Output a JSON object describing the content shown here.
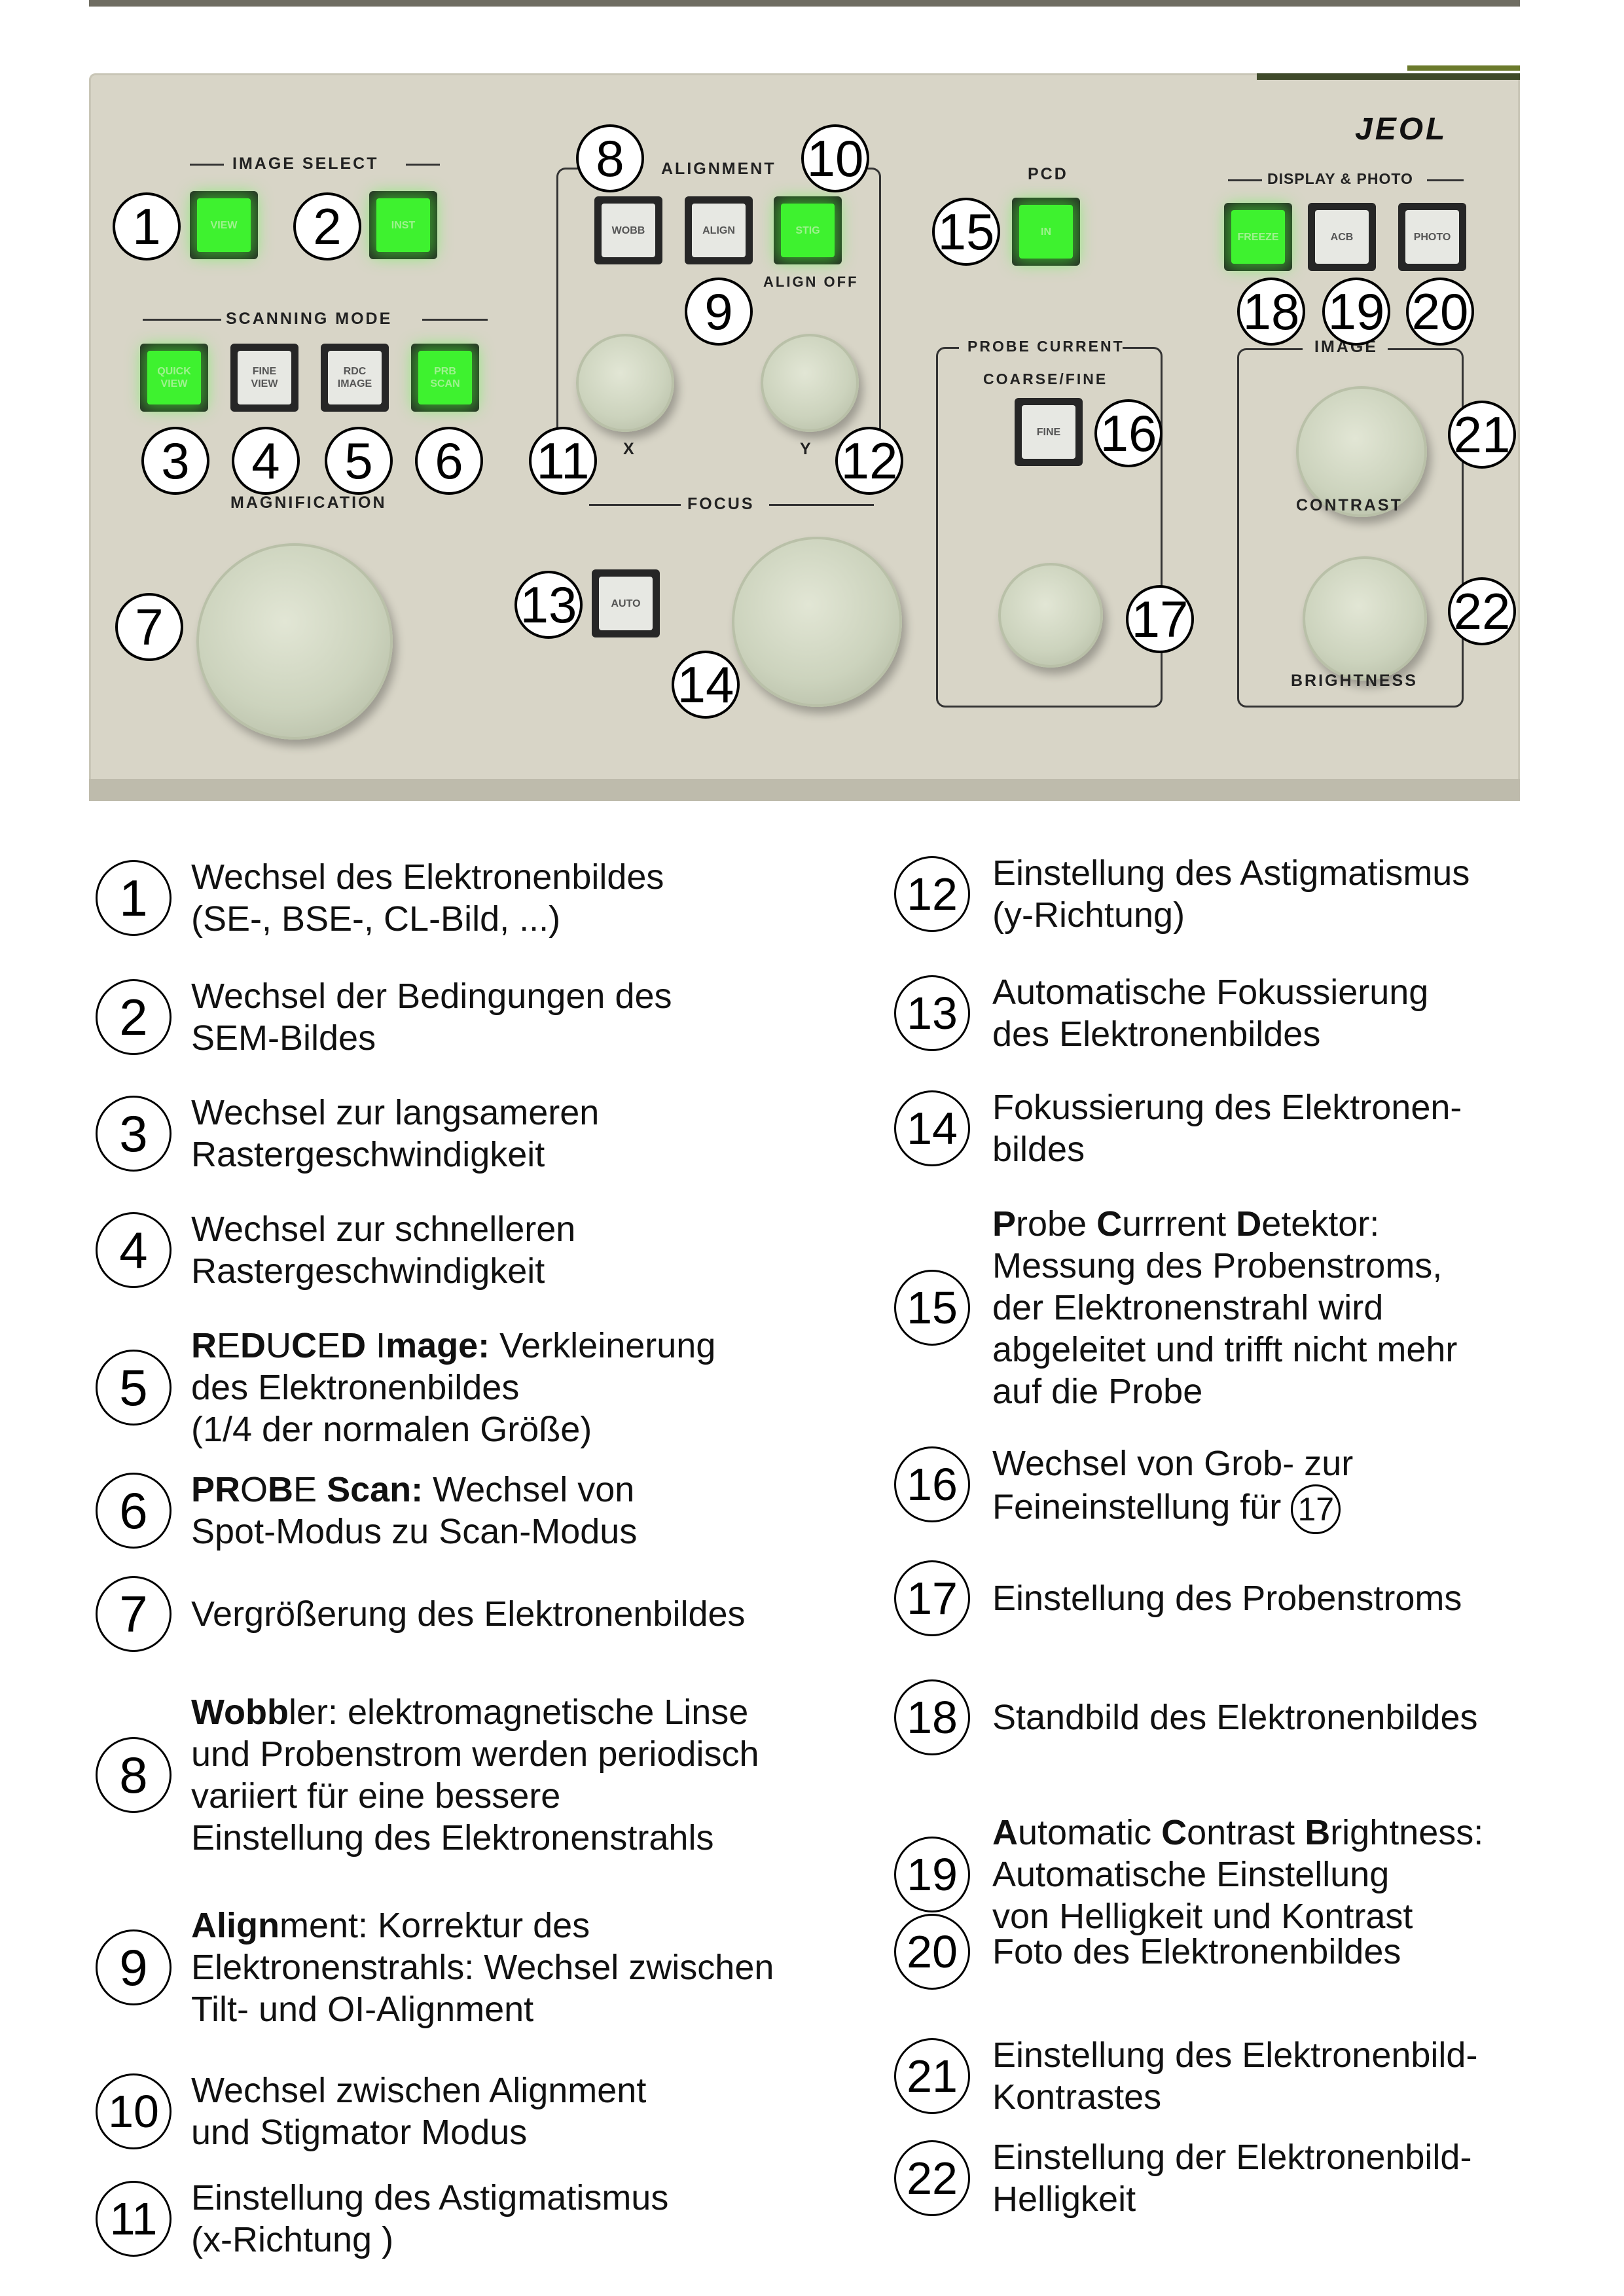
{
  "panel": {
    "brand": "JEOL",
    "sections": {
      "image_select": "IMAGE  SELECT",
      "scanning_mode": "SCANNING  MODE",
      "magnification": "MAGNIFICATION",
      "alignment": "ALIGNMENT",
      "align_off": "ALIGN  OFF",
      "focus": "FOCUS",
      "pcd": "PCD",
      "probe_current": "PROBE  CURRENT",
      "coarse_fine": "COARSE/FINE",
      "display_photo": "DISPLAY & PHOTO",
      "image": "IMAGE",
      "contrast": "CONTRAST",
      "brightness": "BRIGHTNESS",
      "x": "X",
      "y": "Y"
    },
    "buttons": {
      "view": "VIEW",
      "inst": "INST",
      "quick_view": "QUICK\nVIEW",
      "fine_view": "FINE\nVIEW",
      "rdc_image": "RDC\nIMAGE",
      "prb_scan": "PRB\nSCAN",
      "wobb": "WOBB",
      "align": "ALIGN",
      "stig": "STIG",
      "pcd_in": "IN",
      "fine": "FINE",
      "auto": "AUTO",
      "freeze": "FREEZE",
      "acb": "ACB",
      "photo": "PHOTO"
    },
    "callouts": [
      "1",
      "2",
      "3",
      "4",
      "5",
      "6",
      "7",
      "8",
      "9",
      "10",
      "11",
      "12",
      "13",
      "14",
      "15",
      "16",
      "17",
      "18",
      "19",
      "20",
      "21",
      "22"
    ]
  },
  "legend": {
    "left": [
      {
        "num": "1",
        "text": "Wechsel des Elektronenbildes\n(SE-, BSE-, CL-Bild, ...)"
      },
      {
        "num": "2",
        "text": "Wechsel der Bedingungen des\nSEM-Bildes"
      },
      {
        "num": "3",
        "text": "Wechsel zur langsameren\nRastergeschwindigkeit"
      },
      {
        "num": "4",
        "text": "Wechsel zur schnelleren\nRastergeschwindigkeit"
      },
      {
        "num": "5",
        "text": "REDUCED Image: Verkleinerung\ndes Elektronenbildes\n(1/4 der normalen Größe)"
      },
      {
        "num": "6",
        "text": "PROBE Scan: Wechsel von\nSpot-Modus zu Scan-Modus"
      },
      {
        "num": "7",
        "text": "Vergrößerung des Elektronenbildes"
      },
      {
        "num": "8",
        "text": "Wobbler: elektromagnetische Linse\nund Probenstrom  werden periodisch\nvariiert für eine bessere\nEinstellung des Elektronenstrahls"
      },
      {
        "num": "9",
        "text": "Alignment: Korrektur des\nElektronenstrahls: Wechsel zwischen\nTilt- und OI-Alignment"
      },
      {
        "num": "10",
        "text": "Wechsel zwischen Alignment\nund Stigmator Modus"
      },
      {
        "num": "11",
        "text": "Einstellung des Astigmatismus\n(x-Richtung )"
      }
    ],
    "right": [
      {
        "num": "12",
        "text": "Einstellung des Astigmatismus\n(y-Richtung)"
      },
      {
        "num": "13",
        "text": "Automatische Fokussierung\ndes Elektronenbildes"
      },
      {
        "num": "14",
        "text": "Fokussierung des Elektronen-\nbildes"
      },
      {
        "num": "15",
        "text": "Probe Currrent Detektor:\nMessung des Probenstroms,\nder Elektronenstrahl wird\nabgeleitet und  trifft nicht mehr\nauf die Probe"
      },
      {
        "num": "16",
        "text": "Wechsel von Grob- zur\nFeineinstellung für"
      },
      {
        "num": "17",
        "text": "Einstellung des Probenstroms"
      },
      {
        "num": "18",
        "text": "Standbild des Elektronenbildes"
      },
      {
        "num": "19",
        "text": "Automatic Contrast Brightness:\nAutomatische Einstellung\nvon Helligkeit und Kontrast"
      },
      {
        "num": "20",
        "text": "Foto des Elektronenbildes"
      },
      {
        "num": "21",
        "text": "Einstellung des Elektronenbild-\nKontrastes"
      },
      {
        "num": "22",
        "text": "Einstellung der Elektronenbild-\nHelligkeit"
      }
    ],
    "inline_ref": "17"
  }
}
